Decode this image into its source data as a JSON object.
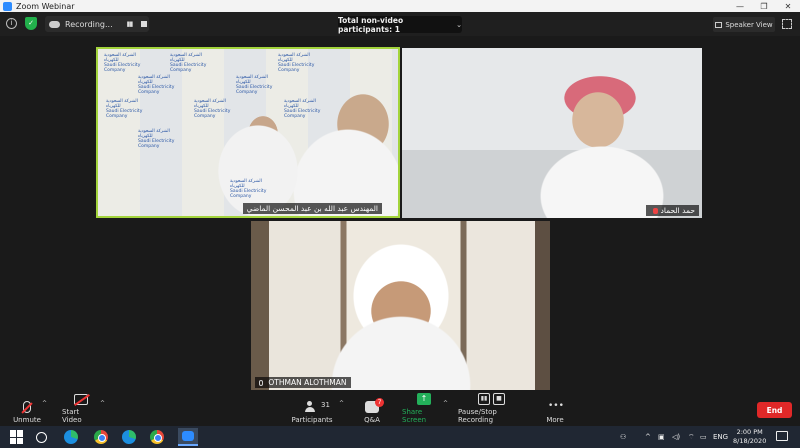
{
  "window": {
    "title": "Zoom Webinar",
    "controls": [
      "—",
      "❐",
      "✕"
    ]
  },
  "topbar": {
    "recording_label": "Recording...",
    "participants_label": "Total non-video participants: 1",
    "speaker_view_label": "Speaker View"
  },
  "tiles": [
    {
      "name": "المهندس عبد الله بن عبد المحسن الماضي",
      "active_speaker": true,
      "logo_text_ar": "الشركة السعودية للكهرباء",
      "logo_text_en": "Saudi Electricity Company"
    },
    {
      "name": "حمد الحماد",
      "muted": true
    },
    {
      "name": "OTHMAN ALOTHMAN"
    }
  ],
  "toolbar": {
    "unmute": "Unmute",
    "start_video": "Start Video",
    "participants": "Participants",
    "participants_count": "31",
    "qa": "Q&A",
    "qa_badge": "7",
    "share_screen": "Share Screen",
    "pause_recording": "Pause/Stop Recording",
    "more": "More",
    "end": "End"
  },
  "taskbar": {
    "language": "ENG",
    "time": "2:00 PM",
    "date": "8/18/2020"
  },
  "colors": {
    "active_speaker_border": "#a3d43c",
    "share_green": "#23b05a",
    "end_red": "#e02828",
    "shield_green": "#22b14c"
  }
}
